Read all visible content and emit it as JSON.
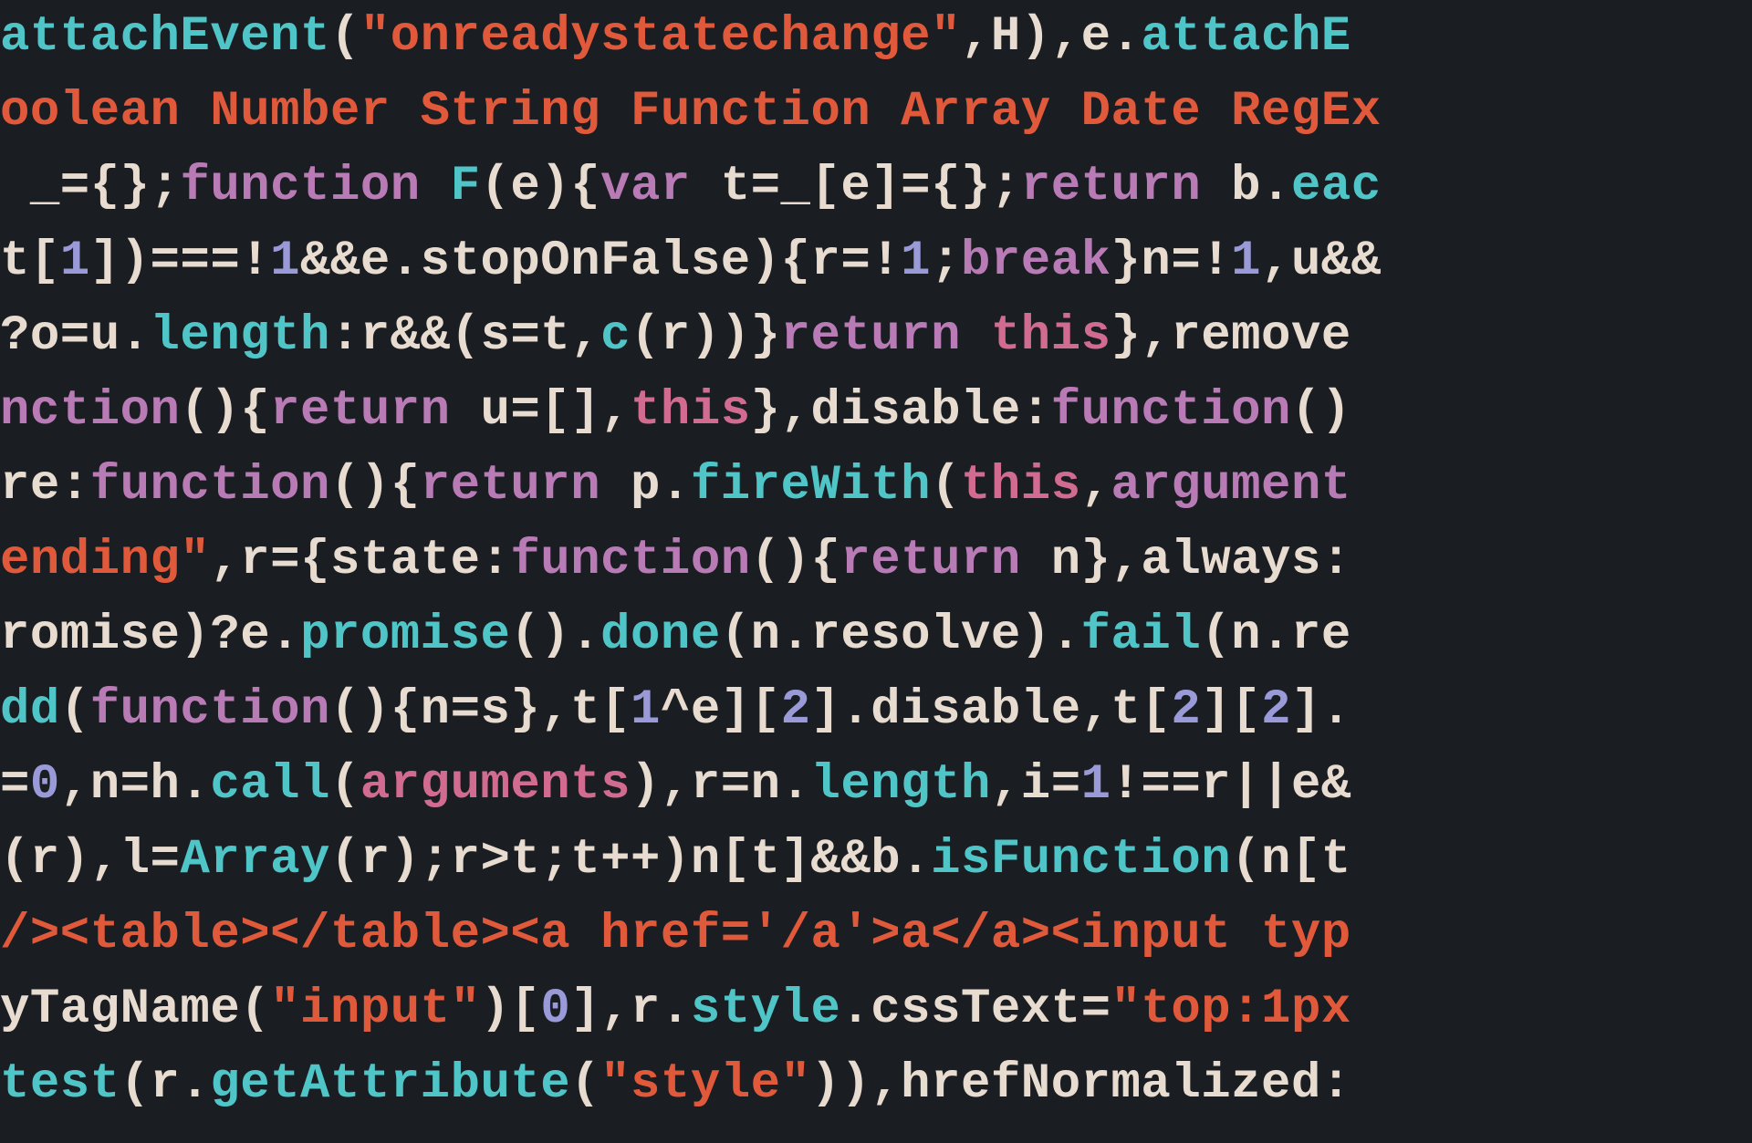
{
  "code": {
    "lines": [
      {
        "tokens": [
          {
            "cls": "c-cyan",
            "t": "attachEvent"
          },
          {
            "cls": "c-default",
            "t": "("
          },
          {
            "cls": "c-orange",
            "t": "\"onreadystatechange\""
          },
          {
            "cls": "c-default",
            "t": ",H),e."
          },
          {
            "cls": "c-cyan",
            "t": "attachE"
          }
        ]
      },
      {
        "tokens": [
          {
            "cls": "c-orange",
            "t": "oolean Number String Function Array Date RegEx"
          }
        ]
      },
      {
        "tokens": [
          {
            "cls": "c-default",
            "t": " _={};"
          },
          {
            "cls": "c-purple",
            "t": "function"
          },
          {
            "cls": "c-default",
            "t": " "
          },
          {
            "cls": "c-cyan",
            "t": "F"
          },
          {
            "cls": "c-default",
            "t": "(e){"
          },
          {
            "cls": "c-purple",
            "t": "var"
          },
          {
            "cls": "c-default",
            "t": " t=_[e]={};"
          },
          {
            "cls": "c-purple",
            "t": "return"
          },
          {
            "cls": "c-default",
            "t": " b."
          },
          {
            "cls": "c-cyan",
            "t": "eac"
          }
        ]
      },
      {
        "tokens": [
          {
            "cls": "c-default",
            "t": "t["
          },
          {
            "cls": "c-lav",
            "t": "1"
          },
          {
            "cls": "c-default",
            "t": "])===!"
          },
          {
            "cls": "c-lav",
            "t": "1"
          },
          {
            "cls": "c-default",
            "t": "&&e.stopOnFalse){r=!"
          },
          {
            "cls": "c-lav",
            "t": "1"
          },
          {
            "cls": "c-default",
            "t": ";"
          },
          {
            "cls": "c-purple",
            "t": "break"
          },
          {
            "cls": "c-default",
            "t": "}n=!"
          },
          {
            "cls": "c-lav",
            "t": "1"
          },
          {
            "cls": "c-default",
            "t": ",u&&"
          }
        ]
      },
      {
        "tokens": [
          {
            "cls": "c-default",
            "t": "?o=u."
          },
          {
            "cls": "c-cyan",
            "t": "length"
          },
          {
            "cls": "c-default",
            "t": ":r&&(s=t,"
          },
          {
            "cls": "c-cyan",
            "t": "c"
          },
          {
            "cls": "c-default",
            "t": "(r))}"
          },
          {
            "cls": "c-purple",
            "t": "return"
          },
          {
            "cls": "c-default",
            "t": " "
          },
          {
            "cls": "c-pink",
            "t": "this"
          },
          {
            "cls": "c-default",
            "t": "},remove"
          }
        ]
      },
      {
        "tokens": [
          {
            "cls": "c-purple",
            "t": "nction"
          },
          {
            "cls": "c-default",
            "t": "(){"
          },
          {
            "cls": "c-purple",
            "t": "return"
          },
          {
            "cls": "c-default",
            "t": " u=[],"
          },
          {
            "cls": "c-pink",
            "t": "this"
          },
          {
            "cls": "c-default",
            "t": "},disable:"
          },
          {
            "cls": "c-purple",
            "t": "function"
          },
          {
            "cls": "c-default",
            "t": "()"
          }
        ]
      },
      {
        "tokens": [
          {
            "cls": "c-default",
            "t": "re:"
          },
          {
            "cls": "c-purple",
            "t": "function"
          },
          {
            "cls": "c-default",
            "t": "(){"
          },
          {
            "cls": "c-purple",
            "t": "return"
          },
          {
            "cls": "c-default",
            "t": " p."
          },
          {
            "cls": "c-cyan",
            "t": "fireWith"
          },
          {
            "cls": "c-default",
            "t": "("
          },
          {
            "cls": "c-pink",
            "t": "this"
          },
          {
            "cls": "c-default",
            "t": ","
          },
          {
            "cls": "c-purple",
            "t": "argument"
          }
        ]
      },
      {
        "tokens": [
          {
            "cls": "c-orange",
            "t": "ending\""
          },
          {
            "cls": "c-default",
            "t": ",r={state:"
          },
          {
            "cls": "c-purple",
            "t": "function"
          },
          {
            "cls": "c-default",
            "t": "(){"
          },
          {
            "cls": "c-purple",
            "t": "return"
          },
          {
            "cls": "c-default",
            "t": " n},always:"
          }
        ]
      },
      {
        "tokens": [
          {
            "cls": "c-default",
            "t": "romise)?e."
          },
          {
            "cls": "c-cyan",
            "t": "promise"
          },
          {
            "cls": "c-default",
            "t": "()."
          },
          {
            "cls": "c-cyan",
            "t": "done"
          },
          {
            "cls": "c-default",
            "t": "(n.resolve)."
          },
          {
            "cls": "c-cyan",
            "t": "fail"
          },
          {
            "cls": "c-default",
            "t": "(n.re"
          }
        ]
      },
      {
        "tokens": [
          {
            "cls": "c-cyan",
            "t": "dd"
          },
          {
            "cls": "c-default",
            "t": "("
          },
          {
            "cls": "c-purple",
            "t": "function"
          },
          {
            "cls": "c-default",
            "t": "(){n=s},t["
          },
          {
            "cls": "c-lav",
            "t": "1"
          },
          {
            "cls": "c-default",
            "t": "^e]["
          },
          {
            "cls": "c-lav",
            "t": "2"
          },
          {
            "cls": "c-default",
            "t": "].disable,t["
          },
          {
            "cls": "c-lav",
            "t": "2"
          },
          {
            "cls": "c-default",
            "t": "]["
          },
          {
            "cls": "c-lav",
            "t": "2"
          },
          {
            "cls": "c-default",
            "t": "]."
          }
        ]
      },
      {
        "tokens": [
          {
            "cls": "c-default",
            "t": "="
          },
          {
            "cls": "c-lav",
            "t": "0"
          },
          {
            "cls": "c-default",
            "t": ",n=h."
          },
          {
            "cls": "c-cyan",
            "t": "call"
          },
          {
            "cls": "c-default",
            "t": "("
          },
          {
            "cls": "c-pink",
            "t": "arguments"
          },
          {
            "cls": "c-default",
            "t": "),r=n."
          },
          {
            "cls": "c-cyan",
            "t": "length"
          },
          {
            "cls": "c-default",
            "t": ",i="
          },
          {
            "cls": "c-lav",
            "t": "1"
          },
          {
            "cls": "c-default",
            "t": "!==r||e&"
          }
        ]
      },
      {
        "tokens": [
          {
            "cls": "c-default",
            "t": "(r),l="
          },
          {
            "cls": "c-cyan",
            "t": "Array"
          },
          {
            "cls": "c-default",
            "t": "(r);r>t;t++)n[t]&&b."
          },
          {
            "cls": "c-cyan",
            "t": "isFunction"
          },
          {
            "cls": "c-default",
            "t": "(n[t"
          }
        ]
      },
      {
        "tokens": [
          {
            "cls": "c-orange",
            "t": "/><table></table><a href='/a'>a</a><input typ"
          }
        ]
      },
      {
        "tokens": [
          {
            "cls": "c-default",
            "t": "yTagName("
          },
          {
            "cls": "c-orange",
            "t": "\"input\""
          },
          {
            "cls": "c-default",
            "t": ")["
          },
          {
            "cls": "c-lav",
            "t": "0"
          },
          {
            "cls": "c-default",
            "t": "],r."
          },
          {
            "cls": "c-cyan",
            "t": "style"
          },
          {
            "cls": "c-default",
            "t": ".cssText="
          },
          {
            "cls": "c-orange",
            "t": "\"top:1px"
          }
        ]
      },
      {
        "tokens": [
          {
            "cls": "c-cyan",
            "t": "test"
          },
          {
            "cls": "c-default",
            "t": "(r."
          },
          {
            "cls": "c-cyan",
            "t": "getAttribute"
          },
          {
            "cls": "c-default",
            "t": "("
          },
          {
            "cls": "c-orange",
            "t": "\"style\""
          },
          {
            "cls": "c-default",
            "t": ")),hrefNormalized:"
          }
        ]
      }
    ]
  }
}
